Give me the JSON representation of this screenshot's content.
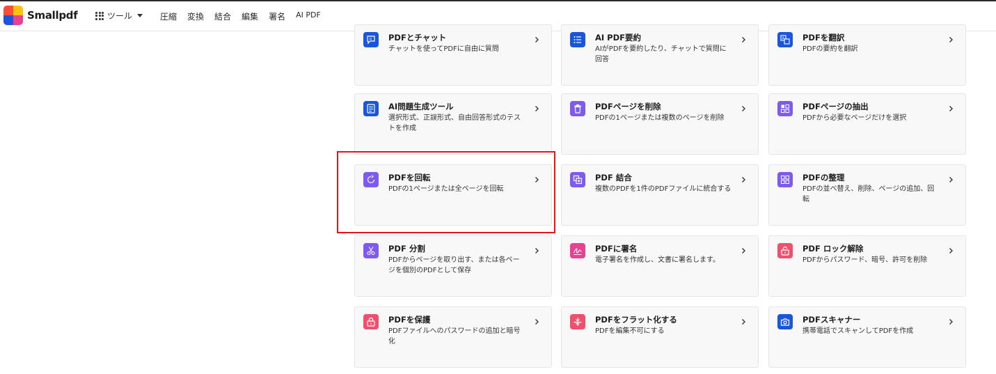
{
  "navbar": {
    "brand": "Smallpdf",
    "tools_label": "ツール",
    "links": [
      "圧縮",
      "変換",
      "結合",
      "編集",
      "署名",
      "AI PDF"
    ]
  },
  "colors": {
    "blue": "#1a56db",
    "purple": "#7e5bef",
    "pink": "#e74291",
    "red": "#f0506e",
    "highlight": "#e3141a"
  },
  "cards": [
    {
      "title": "PDFとチャット",
      "desc": "チャットを使ってPDFに自由に質問",
      "icon": "chat-ai-icon",
      "color": "#1a56db"
    },
    {
      "title": "AI PDF要約",
      "desc": "AIがPDFを要約したり、チャットで質問に回答",
      "icon": "list-icon",
      "color": "#1a56db"
    },
    {
      "title": "PDFを翻訳",
      "desc": "PDFの要約を翻訳",
      "icon": "translate-icon",
      "color": "#1a56db"
    },
    {
      "title": "AI問題生成ツール",
      "desc": "選択形式、正誤形式、自由回答形式のテストを作成",
      "icon": "quiz-icon",
      "color": "#1a56db"
    },
    {
      "title": "PDFページを削除",
      "desc": "PDFの1ページまたは複数のページを削除",
      "icon": "trash-icon",
      "color": "#7e5bef"
    },
    {
      "title": "PDFページの抽出",
      "desc": "PDFから必要なページだけを選択",
      "icon": "extract-icon",
      "color": "#7e5bef"
    },
    {
      "title": "PDFを回転",
      "desc": "PDFの1ページまたは全ページを回転",
      "icon": "rotate-icon",
      "color": "#7e5bef"
    },
    {
      "title": "PDF 結合",
      "desc": "複数のPDFを1件のPDFファイルに統合する",
      "icon": "merge-icon",
      "color": "#7e5bef"
    },
    {
      "title": "PDFの整理",
      "desc": "PDFの並べ替え、削除、ページの追加、回転",
      "icon": "organize-icon",
      "color": "#7e5bef"
    },
    {
      "title": "PDF 分割",
      "desc": "PDFからページを取り出す、または各ページを個別のPDFとして保存",
      "icon": "scissors-icon",
      "color": "#7e5bef"
    },
    {
      "title": "PDFに署名",
      "desc": "電子署名を作成し、文書に署名します。",
      "icon": "signature-icon",
      "color": "#e74291"
    },
    {
      "title": "PDF ロック解除",
      "desc": "PDFからパスワード、暗号、許可を削除",
      "icon": "unlock-icon",
      "color": "#f0506e"
    },
    {
      "title": "PDFを保護",
      "desc": "PDFファイルへのパスワードの追加と暗号化",
      "icon": "lock-icon",
      "color": "#f0506e"
    },
    {
      "title": "PDFをフラット化する",
      "desc": "PDFを編集不可にする",
      "icon": "flatten-icon",
      "color": "#f0506e"
    },
    {
      "title": "PDFスキャナー",
      "desc": "携帯電話でスキャンしてPDFを作成",
      "icon": "camera-icon",
      "color": "#1a56db"
    }
  ]
}
